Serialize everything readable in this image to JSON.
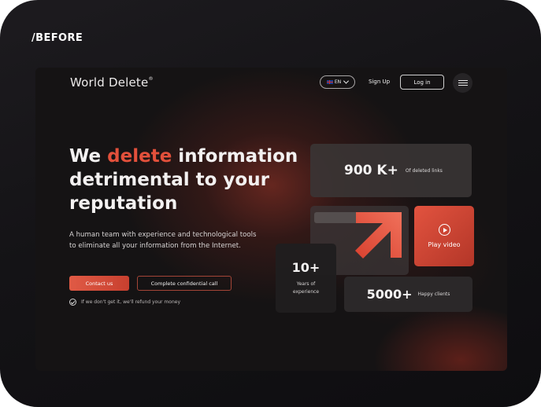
{
  "frame": {
    "label": "/BEFORE"
  },
  "header": {
    "logo_text": "World Delete",
    "logo_mark": "®",
    "language": "EN",
    "signup_label": "Sign Up",
    "login_label": "Log in"
  },
  "hero": {
    "title_part1": "We ",
    "title_accent": "delete",
    "title_part2": " information detrimental to your reputation",
    "description": "A human team with experience and technological tools to eliminate all your information from the Internet.",
    "contact_label": "Contact us",
    "call_label": "Complete confidential call",
    "guarantee": "If we don't get it, we'll refund your money"
  },
  "stats": {
    "links_value": "900 K+",
    "links_label": "Of deleted links",
    "years_value": "10+",
    "years_label_line1": "Years of",
    "years_label_line2": "experience",
    "clients_value": "5000+",
    "clients_label": "Happy clients"
  },
  "video": {
    "label": "Play video"
  },
  "colors": {
    "accent": "#e2503b",
    "background": "#151314",
    "card": "#3a3536"
  },
  "icons": [
    "uk-flag-icon",
    "chevron-down-icon",
    "menu-icon",
    "play-icon",
    "check-circle-icon",
    "arrow-up-right-icon"
  ]
}
